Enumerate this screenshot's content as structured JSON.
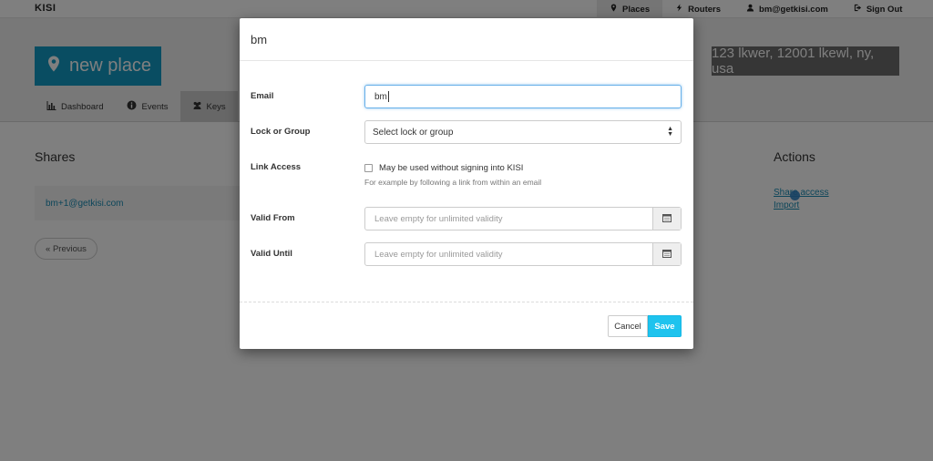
{
  "app": {
    "brand": "KISI"
  },
  "topnav": [
    {
      "label": "Places",
      "icon": "map-marker-icon",
      "active": true
    },
    {
      "label": "Routers",
      "icon": "bolt-icon"
    },
    {
      "label": "bm@getkisi.com",
      "icon": "user-icon"
    },
    {
      "label": "Sign Out",
      "icon": "sign-out-icon"
    }
  ],
  "place": {
    "name": "new place",
    "address": "123 lkwer, 12001 lkewl, ny, usa"
  },
  "tabs": [
    {
      "label": "Dashboard",
      "icon": "bar-chart-icon"
    },
    {
      "label": "Events",
      "icon": "info-circle-icon"
    },
    {
      "label": "Keys",
      "icon": "users-icon",
      "active": true
    }
  ],
  "shares": {
    "heading": "Shares",
    "items": [
      "bm+1@getkisi.com"
    ],
    "previous_label": "« Previous"
  },
  "actions": {
    "heading": "Actions",
    "links": [
      "Share access",
      "Import"
    ]
  },
  "modal": {
    "title": "bm",
    "email": {
      "label": "Email",
      "value": "bm"
    },
    "lock_group": {
      "label": "Lock or Group",
      "selected": "Select lock or group"
    },
    "link_access": {
      "label": "Link Access",
      "checkbox_label": "May be used without signing into KISI",
      "checked": false,
      "help": "For example by following a link from within an email"
    },
    "valid_from": {
      "label": "Valid From",
      "placeholder": "Leave empty for unlimited validity",
      "icon": "calendar-icon"
    },
    "valid_until": {
      "label": "Valid Until",
      "placeholder": "Leave empty for unlimited validity",
      "icon": "calendar-icon"
    },
    "cancel_label": "Cancel",
    "save_label": "Save"
  },
  "colors": {
    "accent": "#129bc4",
    "save": "#1ec3ee",
    "link": "#1a8cb5"
  }
}
